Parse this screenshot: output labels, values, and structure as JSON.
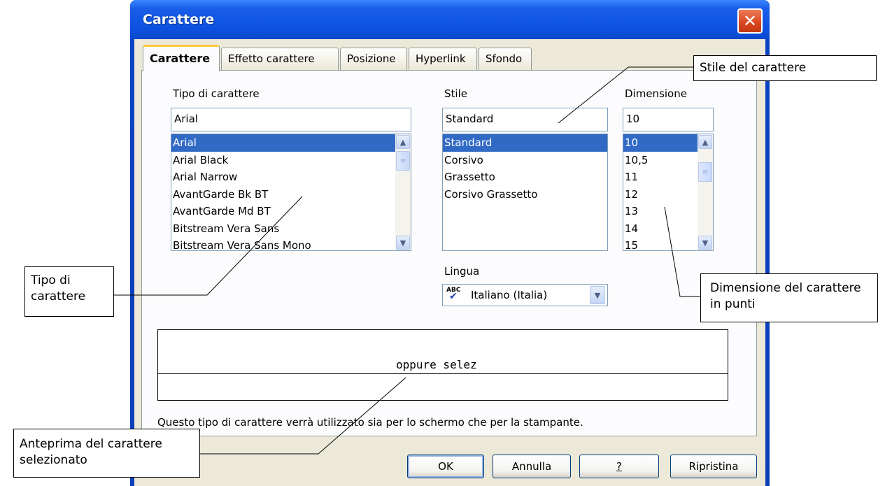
{
  "dialog": {
    "title": "Carattere",
    "close_icon": "close-icon",
    "close_glyph": "✕"
  },
  "tabs": [
    {
      "label": "Carattere",
      "active": true
    },
    {
      "label": "Effetto carattere",
      "active": false
    },
    {
      "label": "Posizione",
      "active": false
    },
    {
      "label": "Hyperlink",
      "active": false
    },
    {
      "label": "Sfondo",
      "active": false
    }
  ],
  "font_family": {
    "label": "Tipo di carattere",
    "value": "Arial",
    "items": [
      "Arial",
      "Arial Black",
      "Arial Narrow",
      "AvantGarde Bk BT",
      "AvantGarde Md BT",
      "Bitstream Vera Sans",
      "Bitstream Vera Sans Mono"
    ],
    "selected_index": 0
  },
  "style": {
    "label": "Stile",
    "value": "Standard",
    "items": [
      "Standard",
      "Corsivo",
      "Grassetto",
      "Corsivo Grassetto"
    ],
    "selected_index": 0
  },
  "size": {
    "label": "Dimensione",
    "value": "10",
    "items": [
      "10",
      "10,5",
      "11",
      "12",
      "13",
      "14",
      "15"
    ],
    "selected_index": 0
  },
  "language": {
    "label": "Lingua",
    "value": "Italiano (Italia)",
    "icon": "spellcheck-abc-icon",
    "icon_text": "ABC"
  },
  "preview": {
    "text": "oppure selez"
  },
  "info_text": "Questo tipo di carattere verrà utilizzato sia per lo schermo che per la stampante.",
  "buttons": {
    "ok": "OK",
    "cancel": "Annulla",
    "help": "?",
    "reset": "Ripristina"
  },
  "callouts": {
    "style": "Stile del carattere",
    "font_type": "Tipo di carattere",
    "size": "Dimensione del carattere in punti",
    "preview": "Anteprima del carattere selezionato"
  },
  "scroll_glyphs": {
    "up": "▲",
    "down": "▼",
    "thumb": "≡"
  },
  "colors": {
    "titlebar": "#0c52e0",
    "selection": "#316ac5",
    "dialog_bg": "#ece9d8",
    "close": "#d8451e",
    "active_tab_accent": "#ffc83c"
  }
}
